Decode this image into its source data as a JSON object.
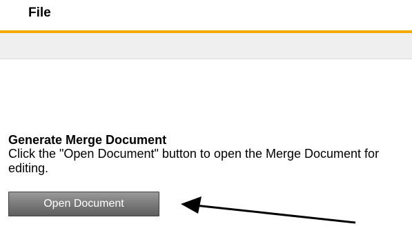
{
  "menu": {
    "file_label": "File"
  },
  "section": {
    "title": "Generate Merge Document",
    "description": "Click the \"Open Document\" button to open the Merge Document for editing."
  },
  "button": {
    "open_document_label": "Open Document"
  },
  "colors": {
    "accent_bar": "#f2a900",
    "button_top": "#9a9a9a",
    "button_bottom": "#5e5e5e",
    "annotation_arrow": "#000000"
  },
  "icons": {
    "annotation": "pointer-arrow-icon"
  }
}
